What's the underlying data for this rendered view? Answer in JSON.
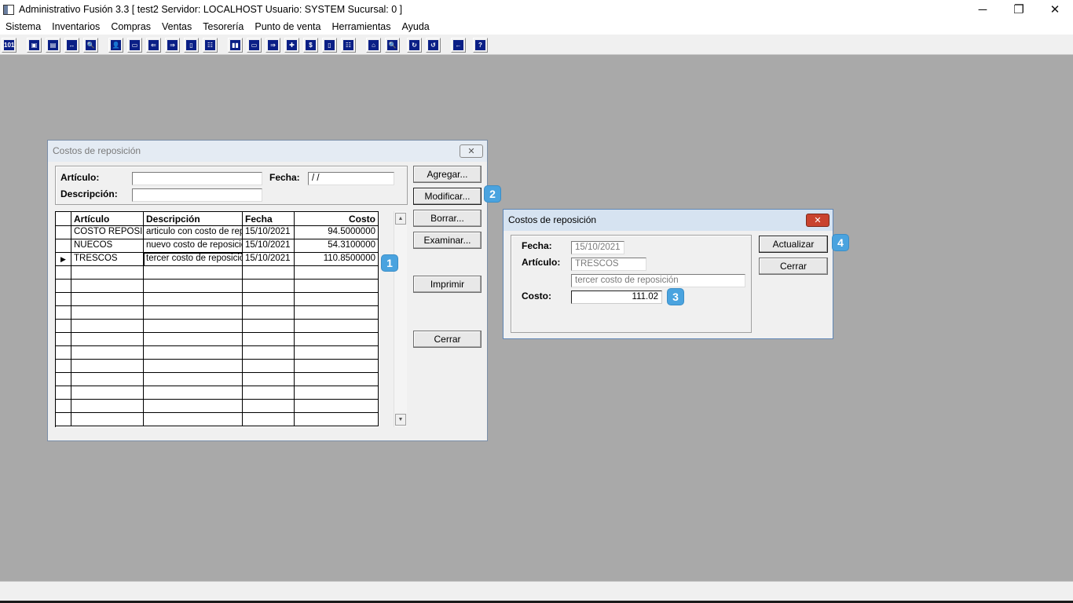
{
  "app": {
    "title": "Administrativo Fusión 3.3 [ test2   Servidor: LOCALHOST   Usuario: SYSTEM     Sucursal: 0 ]"
  },
  "menu": [
    "Sistema",
    "Inventarios",
    "Compras",
    "Ventas",
    "Tesorería",
    "Punto de venta",
    "Herramientas",
    "Ayuda"
  ],
  "window_main": {
    "title": "Costos de reposición",
    "labels": {
      "articulo": "Artículo:",
      "descripcion": "Descripción:",
      "fecha": "Fecha:"
    },
    "fecha_value": " /  /",
    "buttons": {
      "agregar": "Agregar...",
      "modificar": "Modificar...",
      "borrar": "Borrar...",
      "examinar": "Examinar...",
      "imprimir": "Imprimir",
      "cerrar": "Cerrar"
    },
    "grid": {
      "columns": [
        "Artículo",
        "Descripción",
        "Fecha",
        "Costo"
      ],
      "rows": [
        {
          "articulo": "COSTO REPOSICI",
          "descripcion": "articulo con costo de rep",
          "fecha": "15/10/2021",
          "costo": "94.5000000"
        },
        {
          "articulo": "NUECOS",
          "descripcion": "nuevo costo de reposicio",
          "fecha": "15/10/2021",
          "costo": "54.3100000"
        },
        {
          "articulo": "TRESCOS",
          "descripcion": "tercer costo de reposiciò",
          "fecha": "15/10/2021",
          "costo": "110.8500000",
          "current_marker": "▶"
        }
      ]
    }
  },
  "window_edit": {
    "title": "Costos de reposición",
    "labels": {
      "fecha": "Fecha:",
      "articulo": "Artículo:",
      "costo": "Costo:"
    },
    "values": {
      "fecha": "15/10/2021",
      "articulo": "TRESCOS",
      "descripcion": "tercer costo de reposición",
      "costo": "111.02"
    },
    "buttons": {
      "actualizar": "Actualizar",
      "cerrar": "Cerrar"
    },
    "close_glyph": "✕"
  },
  "badges": [
    "1",
    "2",
    "3",
    "4"
  ],
  "icons": {
    "minimize": "─",
    "restore": "❐",
    "close": "✕"
  },
  "toolbar": [
    "101",
    "▣",
    "▤",
    "↔",
    "🔍",
    "👤",
    "▭",
    "⇐",
    "⇒",
    "▯",
    "☷",
    "▮▮",
    "▭",
    "⇒",
    "✚",
    "$",
    "▯",
    "☷",
    "⌂",
    "🔍",
    "↻",
    "↺",
    "←",
    "?"
  ]
}
